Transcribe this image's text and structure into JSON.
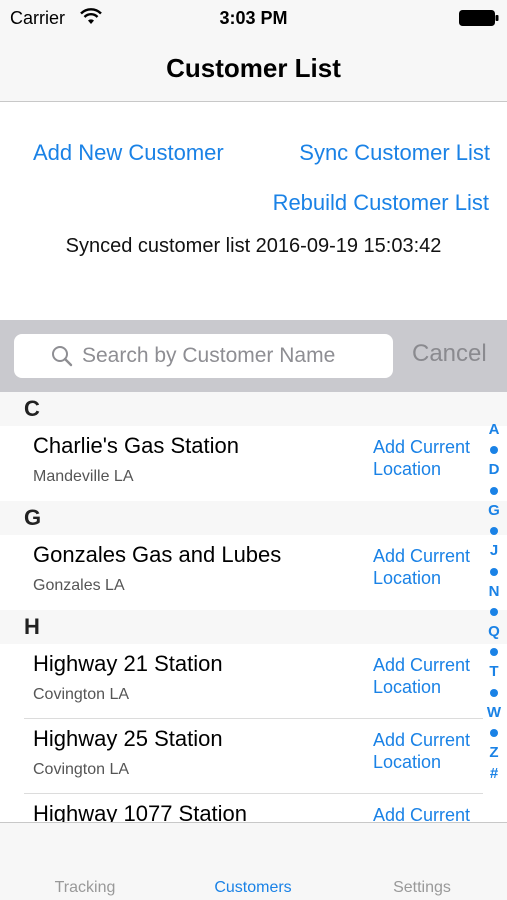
{
  "status_bar": {
    "carrier": "Carrier",
    "time": "3:03 PM"
  },
  "nav": {
    "title": "Customer List"
  },
  "actions": {
    "add_customer": "Add New Customer",
    "sync_list": "Sync Customer List",
    "rebuild_list": "Rebuild Customer List",
    "sync_status": "Synced customer list 2016-09-19 15:03:42"
  },
  "search": {
    "placeholder": "Search by Customer Name",
    "value": "",
    "cancel_label": "Cancel"
  },
  "sections": [
    {
      "letter": "C",
      "rows": [
        {
          "name": "Charlie's Gas Station",
          "location": "Mandeville LA",
          "action": "Add Current Location"
        }
      ]
    },
    {
      "letter": "G",
      "rows": [
        {
          "name": "Gonzales Gas and Lubes",
          "location": "Gonzales LA",
          "action": "Add Current Location"
        }
      ]
    },
    {
      "letter": "H",
      "rows": [
        {
          "name": "Highway 21 Station",
          "location": "Covington LA",
          "action": "Add Current Location"
        },
        {
          "name": "Highway 25 Station",
          "location": "Covington LA",
          "action": "Add Current Location"
        },
        {
          "name": "Highway 1077 Station",
          "location": "",
          "action": "Add Current"
        }
      ]
    }
  ],
  "index_letters": [
    "A",
    "D",
    "G",
    "J",
    "N",
    "Q",
    "T",
    "W",
    "Z",
    "#"
  ],
  "tabs": [
    {
      "label": "Tracking",
      "active": false
    },
    {
      "label": "Customers",
      "active": true
    },
    {
      "label": "Settings",
      "active": false
    }
  ],
  "colors": {
    "accent": "#1a82e6",
    "search_bar_bg": "#c9c9ce",
    "section_bg": "#f7f7f7"
  },
  "icons": {
    "wifi": "wifi-icon",
    "battery": "battery-icon",
    "search": "search-icon"
  }
}
